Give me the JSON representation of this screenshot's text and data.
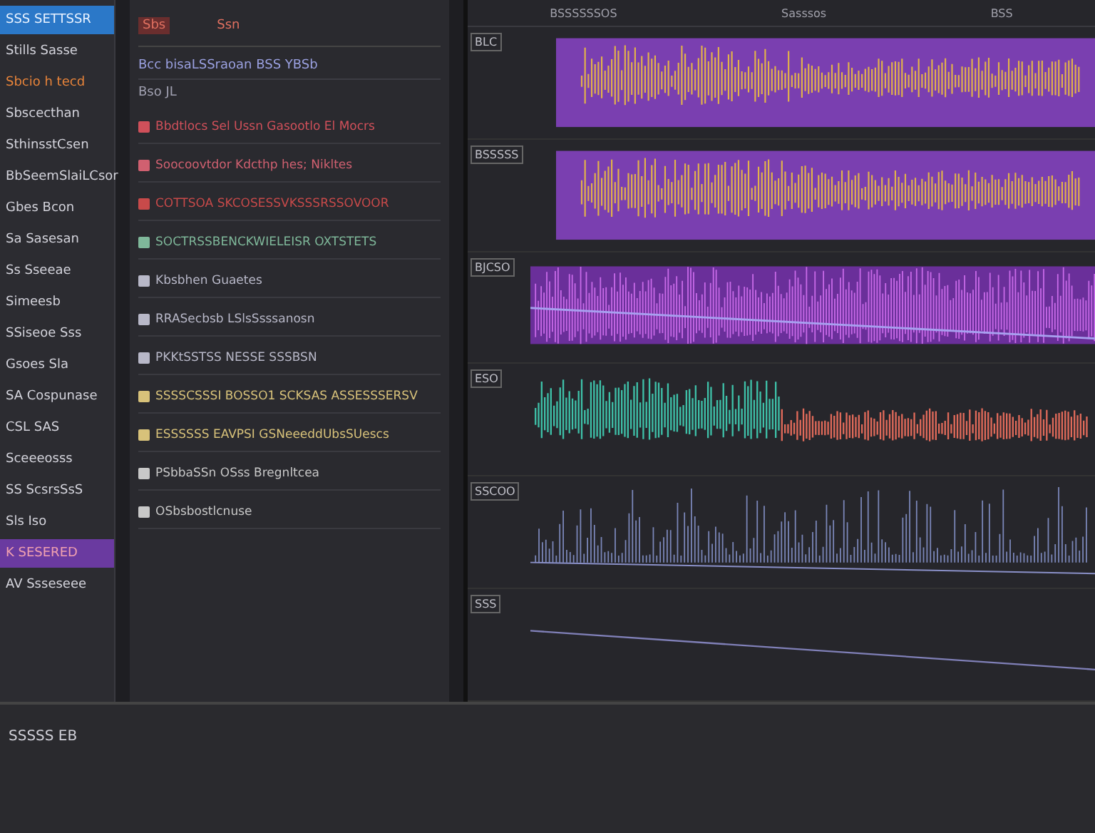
{
  "sidebar": {
    "items": [
      {
        "label": "SSS SETTSSR",
        "selected": true,
        "highlighted": false
      },
      {
        "label": "Stills Sasse",
        "selected": false,
        "highlighted": false
      },
      {
        "label": "Sbcio h tecd",
        "selected": false,
        "highlighted": false,
        "color": "#e8843a"
      },
      {
        "label": "Sbscecthan",
        "selected": false,
        "highlighted": false
      },
      {
        "label": "SthinsstCsen",
        "selected": false,
        "highlighted": false
      },
      {
        "label": "BbSeemSlaiLCsor",
        "selected": false,
        "highlighted": false
      },
      {
        "label": "Gbes Bcon",
        "selected": false,
        "highlighted": false
      },
      {
        "label": "Sa Sasesan",
        "selected": false,
        "highlighted": false
      },
      {
        "label": "Ss Sseeae",
        "selected": false,
        "highlighted": false
      },
      {
        "label": "Simeesb",
        "selected": false,
        "highlighted": false
      },
      {
        "label": "SSiseoe Sss",
        "selected": false,
        "highlighted": false
      },
      {
        "label": "Gsoes Sla",
        "selected": false,
        "highlighted": false
      },
      {
        "label": "SA Cospunase",
        "selected": false,
        "highlighted": false
      },
      {
        "label": "CSL SAS",
        "selected": false,
        "highlighted": false
      },
      {
        "label": "Sceeeosss",
        "selected": false,
        "highlighted": false
      },
      {
        "label": "SS ScsrsSsS",
        "selected": false,
        "highlighted": false
      },
      {
        "label": "Sls Iso",
        "selected": false,
        "highlighted": false
      },
      {
        "label": "K SESERED",
        "selected": false,
        "highlighted": true
      },
      {
        "label": "AV Ssseseee",
        "selected": false,
        "highlighted": false
      }
    ]
  },
  "list": {
    "tabs": [
      "Sbs",
      "Ssn"
    ],
    "header": "Bcc bisaLSSraoan BSS YBSb",
    "subheader": "Bso JL",
    "rows": [
      {
        "label": "Bbdtlocs Sel Ussn Gasootlo El Mocrs",
        "color": "#d0505a"
      },
      {
        "label": "Soocoovtdor Kdcthp hes; Nikltes",
        "color": "#d06070"
      },
      {
        "label": "COTTSOA SKCOSESSVKSSSRSSOVOOR",
        "color": "#c84a4a"
      },
      {
        "label": "SOCTRSSBENCKWIELEISR  OXTSTETS",
        "color": "#7fb89a"
      },
      {
        "label": "Kbsbhen Guaetes",
        "color": "#b8b8c8"
      },
      {
        "label": "RRASecbsb LSlsSsssanosn",
        "color": "#b8b8c8"
      },
      {
        "label": "PKKtSSTSS NESSE SSSBSN",
        "color": "#b8b8c8"
      },
      {
        "label": "SSSSCSSSI BOSSO1 SCKSAS ASSESSSERSV",
        "color": "#d8c27a"
      },
      {
        "label": "ESSSSSS EAVPSI GSNeeeddUbsSUescs",
        "color": "#d8c27a"
      },
      {
        "label": "PSbbaSSn OSss Bregnltcea",
        "color": "#c8c8c8"
      },
      {
        "label": "OSbsbostlcnuse",
        "color": "#c8c8c8"
      }
    ]
  },
  "timeline": {
    "ruler": [
      "BSSSSSSOS",
      "Sasssos",
      "BSS"
    ],
    "tracks": [
      {
        "label": "BLC",
        "kind": "spiky"
      },
      {
        "label": "BSSSSS",
        "kind": "spiky"
      },
      {
        "label": "BJCSO",
        "kind": "dense"
      },
      {
        "label": "ESO",
        "kind": "split"
      },
      {
        "label": "SSCOO",
        "kind": "sparse"
      },
      {
        "label": "SSS",
        "kind": "flat"
      }
    ]
  },
  "footer": {
    "label": "SSSSS EB"
  }
}
